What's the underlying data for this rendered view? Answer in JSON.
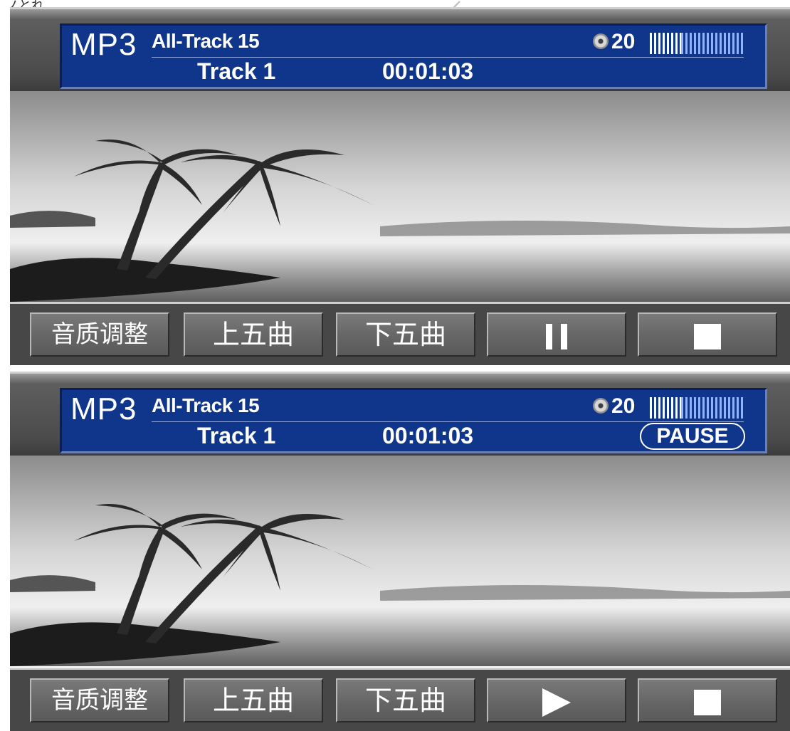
{
  "top_fragment": "ノとれ",
  "player_playing": {
    "format_label": "MP3",
    "track_summary": "All-Track 15",
    "current_track": "Track 1",
    "elapsed_time": "00:01:03",
    "volume": "20",
    "volume_level": 0.33,
    "status": "",
    "buttons": {
      "eq": "音质调整",
      "prev_five": "上五曲",
      "next_five": "下五曲",
      "play_pause_icon": "pause-icon",
      "stop_icon": "stop-icon"
    }
  },
  "player_paused": {
    "format_label": "MP3",
    "track_summary": "All-Track 15",
    "current_track": "Track 1",
    "elapsed_time": "00:01:03",
    "volume": "20",
    "volume_level": 0.33,
    "status": "PAUSE",
    "buttons": {
      "eq": "音质调整",
      "prev_five": "上五曲",
      "next_five": "下五曲",
      "play_pause_icon": "play-icon",
      "stop_icon": "stop-icon"
    }
  },
  "colors": {
    "lcd_background": "#10368c",
    "lcd_text": "#ffffff",
    "button_face": "#646464",
    "bezel": "#4a4a4a"
  }
}
